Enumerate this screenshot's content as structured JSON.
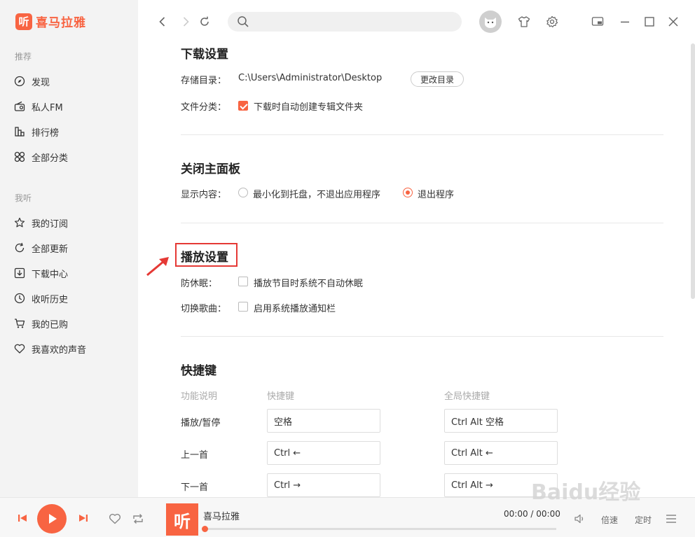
{
  "app": {
    "logo_char": "听",
    "name": "喜马拉雅"
  },
  "sidebar": {
    "section_recommend": "推荐",
    "section_listen": "我听",
    "items": [
      {
        "label": "发现",
        "icon": "compass-icon"
      },
      {
        "label": "私人FM",
        "icon": "radio-icon"
      },
      {
        "label": "排行榜",
        "icon": "chart-icon"
      },
      {
        "label": "全部分类",
        "icon": "grid-icon"
      },
      {
        "label": "我的订阅",
        "icon": "star-icon"
      },
      {
        "label": "全部更新",
        "icon": "refresh-icon"
      },
      {
        "label": "下载中心",
        "icon": "download-icon"
      },
      {
        "label": "收听历史",
        "icon": "clock-icon"
      },
      {
        "label": "我的已购",
        "icon": "cart-icon"
      },
      {
        "label": "我喜欢的声音",
        "icon": "heart-icon"
      }
    ]
  },
  "settings": {
    "download": {
      "title": "下载设置",
      "storage_label": "存储目录：",
      "storage_path": "C:\\Users\\Administrator\\Desktop",
      "change_dir": "更改目录",
      "classify_label": "文件分类：",
      "classify_option": "下载时自动创建专辑文件夹",
      "classify_checked": true
    },
    "close_panel": {
      "title": "关闭主面板",
      "display_label": "显示内容：",
      "option_tray": "最小化到托盘，不退出应用程序",
      "option_exit": "退出程序",
      "selected": "exit"
    },
    "playback": {
      "title": "播放设置",
      "sleep_label": "防休眠：",
      "sleep_option": "播放节目时系统不自动休眠",
      "sleep_checked": false,
      "switch_label": "切换歌曲：",
      "switch_option": "启用系统播放通知栏",
      "switch_checked": false
    },
    "shortcuts": {
      "title": "快捷键",
      "col_function": "功能说明",
      "col_key": "快捷键",
      "col_global": "全局快捷键",
      "rows": [
        {
          "function": "播放/暂停",
          "key": "空格",
          "global": "Ctrl Alt 空格"
        },
        {
          "function": "上一首",
          "key": "Ctrl ←",
          "global": "Ctrl Alt ←"
        },
        {
          "function": "下一首",
          "key": "Ctrl →",
          "global": "Ctrl Alt →"
        }
      ]
    }
  },
  "player": {
    "cover_char": "听",
    "track_title": "喜马拉雅",
    "time": "00:00 / 00:00",
    "progress": 0,
    "speed_label": "倍速",
    "timer_label": "定时"
  },
  "watermark": "Baidu经验",
  "colors": {
    "accent": "#f86442",
    "highlight": "#e53935"
  }
}
